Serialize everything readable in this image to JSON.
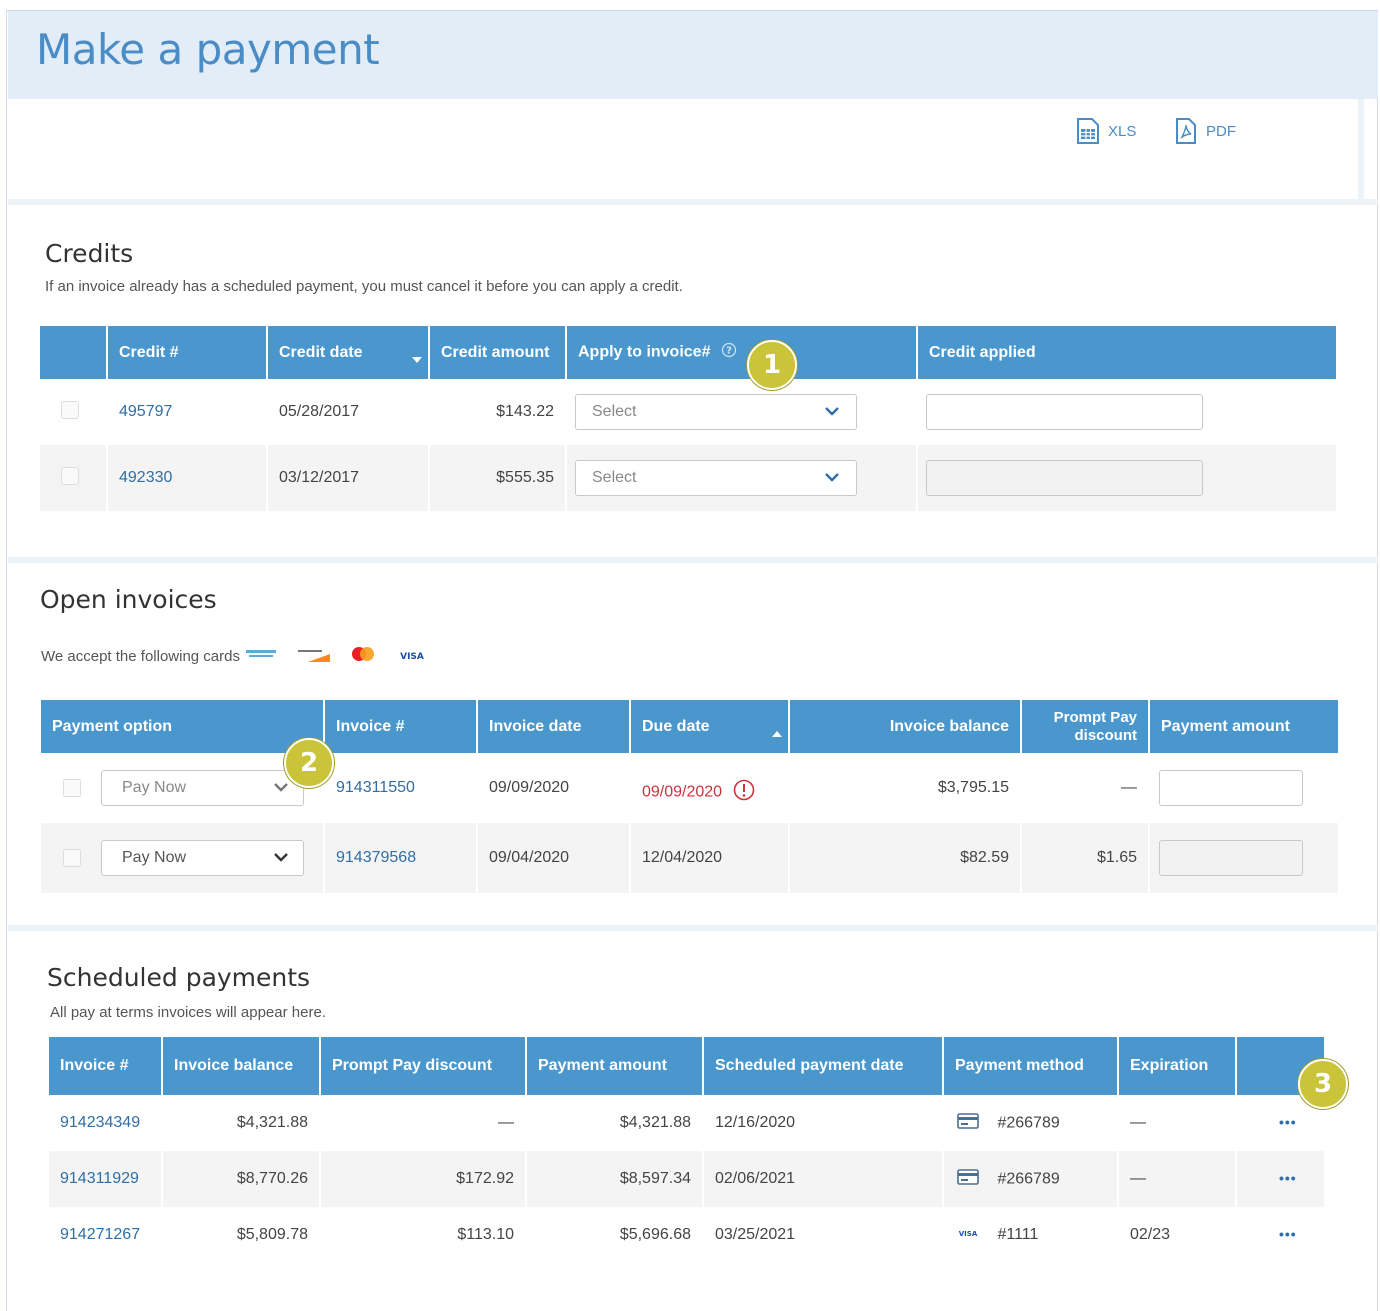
{
  "page": {
    "title": "Make a payment"
  },
  "export": {
    "xls_label": "XLS",
    "pdf_label": "PDF"
  },
  "credits": {
    "title": "Credits",
    "subtitle": "If an invoice already has a scheduled payment, you must cancel it before you can apply a credit.",
    "columns": [
      "Credit #",
      "Credit date",
      "Credit amount",
      "Apply to invoice#",
      "Credit applied"
    ],
    "rows": [
      {
        "credit_no": "495797",
        "date": "05/28/2017",
        "amount": "$143.22",
        "apply": "Select"
      },
      {
        "credit_no": "492330",
        "date": "03/12/2017",
        "amount": "$555.35",
        "apply": "Select"
      }
    ]
  },
  "open_invoices": {
    "title": "Open invoices",
    "cards_text": "We accept the following cards",
    "cards": [
      "amex-card-icon",
      "discover-card-icon",
      "mastercard-icon",
      "visa-card-icon"
    ],
    "columns": [
      "Payment option",
      "Invoice #",
      "Invoice date",
      "Due date",
      "Invoice balance",
      "Prompt Pay discount",
      "Payment amount"
    ],
    "rows": [
      {
        "option": "Pay Now",
        "invoice": "914311550",
        "invoice_date": "09/09/2020",
        "due_date": "09/09/2020",
        "overdue": true,
        "balance": "$3,795.15",
        "discount": "—"
      },
      {
        "option": "Pay Now",
        "invoice": "914379568",
        "invoice_date": "09/04/2020",
        "due_date": "12/04/2020",
        "overdue": false,
        "balance": "$82.59",
        "discount": "$1.65"
      }
    ]
  },
  "scheduled": {
    "title": "Scheduled payments",
    "subtitle": "All pay at terms invoices will appear here.",
    "columns": [
      "Invoice #",
      "Invoice balance",
      "Prompt Pay discount",
      "Payment amount",
      "Scheduled payment date",
      "Payment method",
      "Expiration",
      ""
    ],
    "rows": [
      {
        "invoice": "914234349",
        "balance": "$4,321.88",
        "discount": "—",
        "amount": "$4,321.88",
        "date": "12/16/2020",
        "method_icon": "bank-card-icon",
        "method": "#266789",
        "expiration": "—",
        "menu": "•••"
      },
      {
        "invoice": "914311929",
        "balance": "$8,770.26",
        "discount": "$172.92",
        "amount": "$8,597.34",
        "date": "02/06/2021",
        "method_icon": "bank-card-icon",
        "method": "#266789",
        "expiration": "—",
        "menu": "•••"
      },
      {
        "invoice": "914271267",
        "balance": "$5,809.78",
        "discount": "$113.10",
        "amount": "$5,696.68",
        "date": "03/25/2021",
        "method_icon": "visa-card-icon",
        "method": "#1111",
        "expiration": "02/23",
        "menu": "•••"
      }
    ]
  },
  "callouts": [
    "1",
    "2",
    "3"
  ],
  "colors": {
    "header": "#4a97ce",
    "title": "#4a8cc6",
    "link": "#2f6ea6",
    "callout": "#c9c43a",
    "overdue": "#d0313c"
  }
}
